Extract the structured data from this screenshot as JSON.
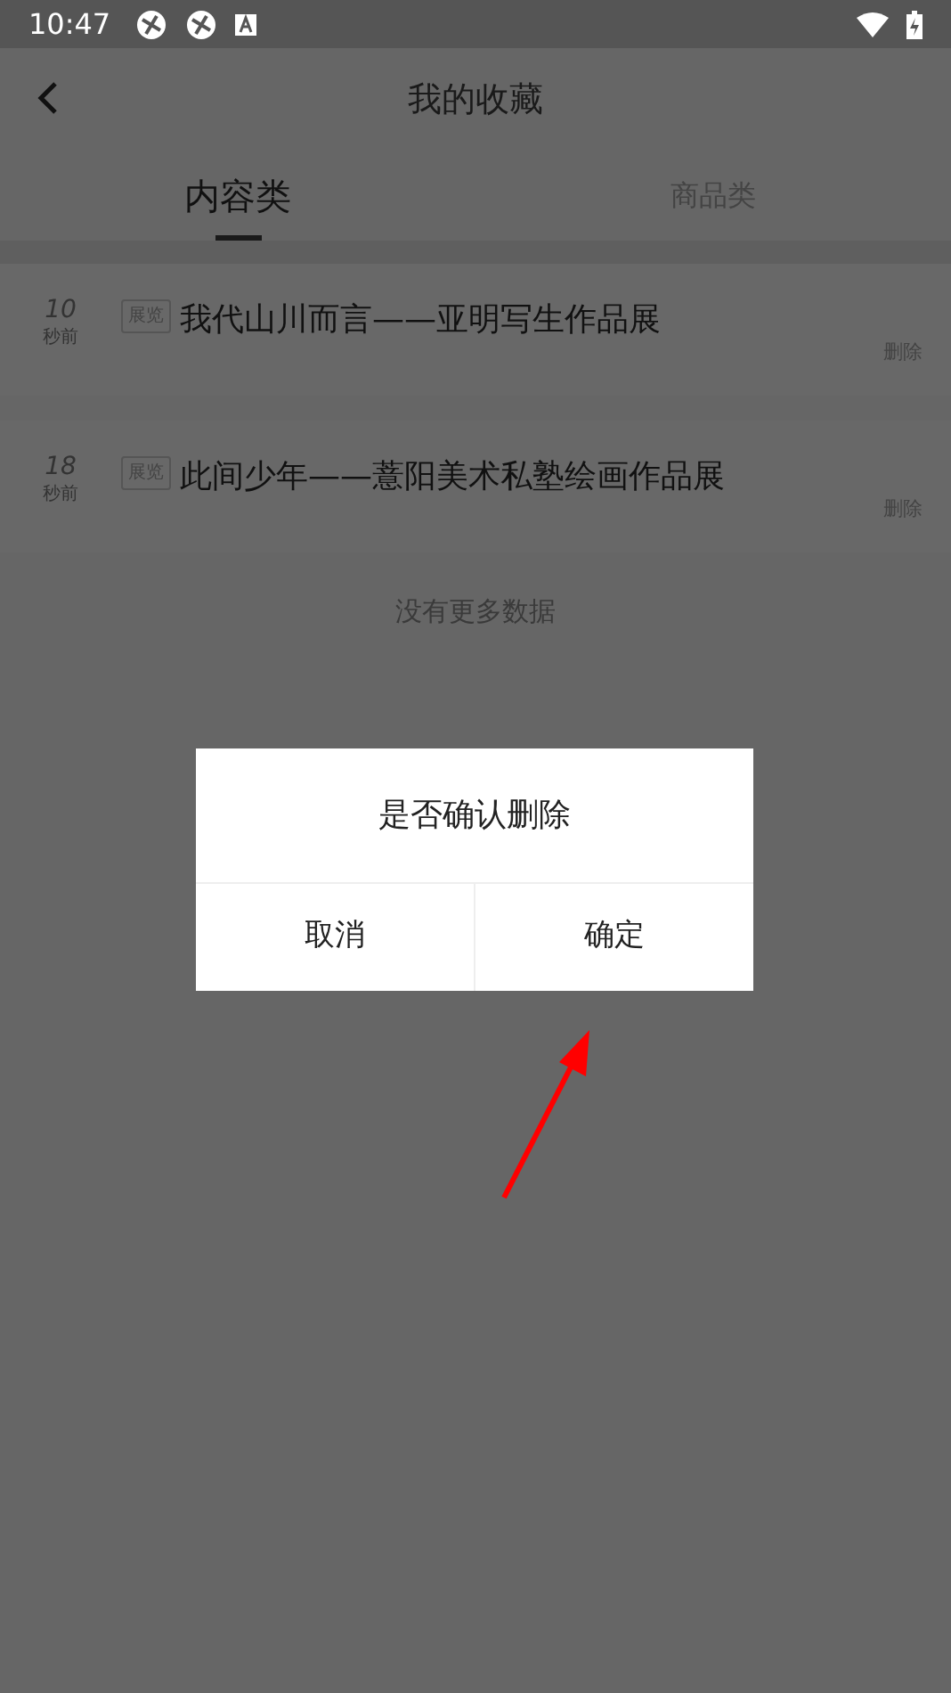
{
  "status_bar": {
    "time": "10:47"
  },
  "header": {
    "title": "我的收藏"
  },
  "tabs": [
    {
      "label": "内容类",
      "selected": true
    },
    {
      "label": "商品类",
      "selected": false
    }
  ],
  "items": [
    {
      "time_value": "10",
      "time_unit": "秒前",
      "tag": "展览",
      "title": "我代山川而言——亚明写生作品展",
      "action": "删除"
    },
    {
      "time_value": "18",
      "time_unit": "秒前",
      "tag": "展览",
      "title": "此间少年——薏阳美术私塾绘画作品展",
      "action": "删除"
    }
  ],
  "footer_note": "没有更多数据",
  "dialog": {
    "message": "是否确认删除",
    "buttons": [
      "取消",
      "确定"
    ]
  }
}
